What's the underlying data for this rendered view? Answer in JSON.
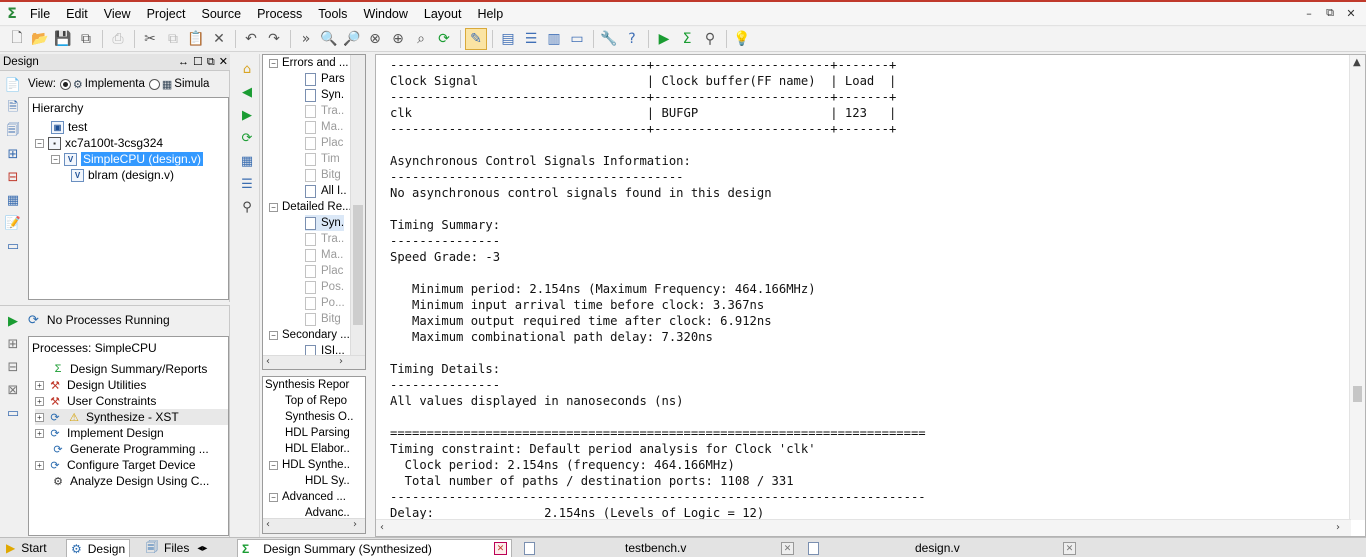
{
  "menu": [
    "File",
    "Edit",
    "View",
    "Project",
    "Source",
    "Process",
    "Tools",
    "Window",
    "Layout",
    "Help"
  ],
  "design_panel": {
    "title": "Design",
    "view_label": "View:",
    "view_impl": "Implementa",
    "view_sim": "Simula",
    "hierarchy_label": "Hierarchy",
    "tree": [
      {
        "label": "test"
      },
      {
        "label": "xc7a100t-3csg324"
      },
      {
        "label": "SimpleCPU (design.v)"
      },
      {
        "label": "blram (design.v)"
      }
    ]
  },
  "processes": {
    "status": "No Processes Running",
    "title": "Processes: SimpleCPU",
    "items": [
      "Design Summary/Reports",
      "Design Utilities",
      "User Constraints",
      "Synthesize - XST",
      "Implement Design",
      "Generate Programming ...",
      "Configure Target Device",
      "Analyze Design Using C..."
    ]
  },
  "nav_tree": {
    "items": [
      "Errors and ...",
      "Pars",
      "Syn.",
      "Tra..",
      "Ma..",
      "Plac",
      "Tim",
      "Bitg",
      "All I..",
      "Detailed Re...",
      "Syn.",
      "Tra..",
      "Ma..",
      "Plac",
      "Pos.",
      "Po...",
      "Bitg",
      "Secondary ...",
      "ISI..."
    ]
  },
  "nav_tree2": {
    "items": [
      "Synthesis Repor",
      "Top of Repo",
      "Synthesis O..",
      "HDL Parsing",
      "HDL Elabor..",
      "HDL Synthe..",
      "HDL Sy..",
      "Advanced ...",
      "Advanc.."
    ]
  },
  "editor_lines": [
    "-----------------------------------+------------------------+-------+",
    "Clock Signal                       | Clock buffer(FF name)  | Load  |",
    "-----------------------------------+------------------------+-------+",
    "clk                                | BUFGP                  | 123   |",
    "-----------------------------------+------------------------+-------+",
    "",
    "Asynchronous Control Signals Information:",
    "----------------------------------------",
    "No asynchronous control signals found in this design",
    "",
    "Timing Summary:",
    "---------------",
    "Speed Grade: -3",
    "",
    "   Minimum period: 2.154ns (Maximum Frequency: 464.166MHz)",
    "   Minimum input arrival time before clock: 3.367ns",
    "   Maximum output required time after clock: 6.912ns",
    "   Maximum combinational path delay: 7.320ns",
    "",
    "Timing Details:",
    "---------------",
    "All values displayed in nanoseconds (ns)",
    "",
    "=========================================================================",
    "Timing constraint: Default period analysis for Clock 'clk'",
    "  Clock period: 2.154ns (frequency: 464.166MHz)",
    "  Total number of paths / destination ports: 1108 / 331",
    "-------------------------------------------------------------------------",
    "Delay:               2.154ns (Levels of Logic = 12)"
  ],
  "bottom_tabs": {
    "start": "Start",
    "design": "Design",
    "files": "Files",
    "doc1": "Design Summary (Synthesized)",
    "doc2": "testbench.v",
    "doc3": "design.v"
  }
}
